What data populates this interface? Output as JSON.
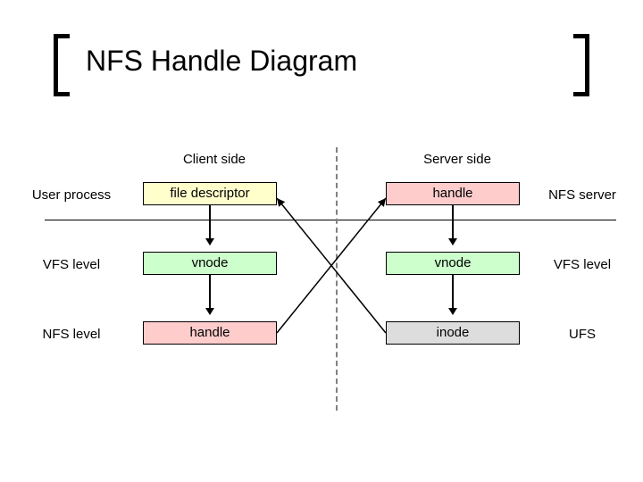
{
  "title": "NFS Handle Diagram",
  "columns": {
    "client": "Client side",
    "server": "Server side"
  },
  "rows": {
    "left": [
      "User process",
      "VFS level",
      "NFS level"
    ],
    "right": [
      "NFS server",
      "VFS level",
      "UFS"
    ]
  },
  "boxes": {
    "client": [
      "file descriptor",
      "vnode",
      "handle"
    ],
    "server": [
      "handle",
      "vnode",
      "inode"
    ]
  },
  "chart_data": {
    "type": "flow",
    "title": "NFS Handle Diagram",
    "columns": [
      "Client side",
      "Server side"
    ],
    "client_row_labels": [
      "User process",
      "VFS level",
      "NFS level"
    ],
    "server_row_labels": [
      "NFS server",
      "VFS level",
      "UFS"
    ],
    "nodes": [
      {
        "id": "c0",
        "column": "Client side",
        "row": 0,
        "label": "file descriptor",
        "color": "yellow"
      },
      {
        "id": "c1",
        "column": "Client side",
        "row": 1,
        "label": "vnode",
        "color": "green"
      },
      {
        "id": "c2",
        "column": "Client side",
        "row": 2,
        "label": "handle",
        "color": "red"
      },
      {
        "id": "s0",
        "column": "Server side",
        "row": 0,
        "label": "handle",
        "color": "red"
      },
      {
        "id": "s1",
        "column": "Server side",
        "row": 1,
        "label": "vnode",
        "color": "green"
      },
      {
        "id": "s2",
        "column": "Server side",
        "row": 2,
        "label": "inode",
        "color": "grey"
      }
    ],
    "edges": [
      {
        "from": "c0",
        "to": "c1"
      },
      {
        "from": "c1",
        "to": "c2"
      },
      {
        "from": "s0",
        "to": "s1"
      },
      {
        "from": "s1",
        "to": "s2"
      },
      {
        "from": "c2",
        "to": "s0",
        "note": "cross client→server"
      },
      {
        "from": "s0",
        "to": "c2",
        "note": "cross server→client"
      }
    ]
  }
}
